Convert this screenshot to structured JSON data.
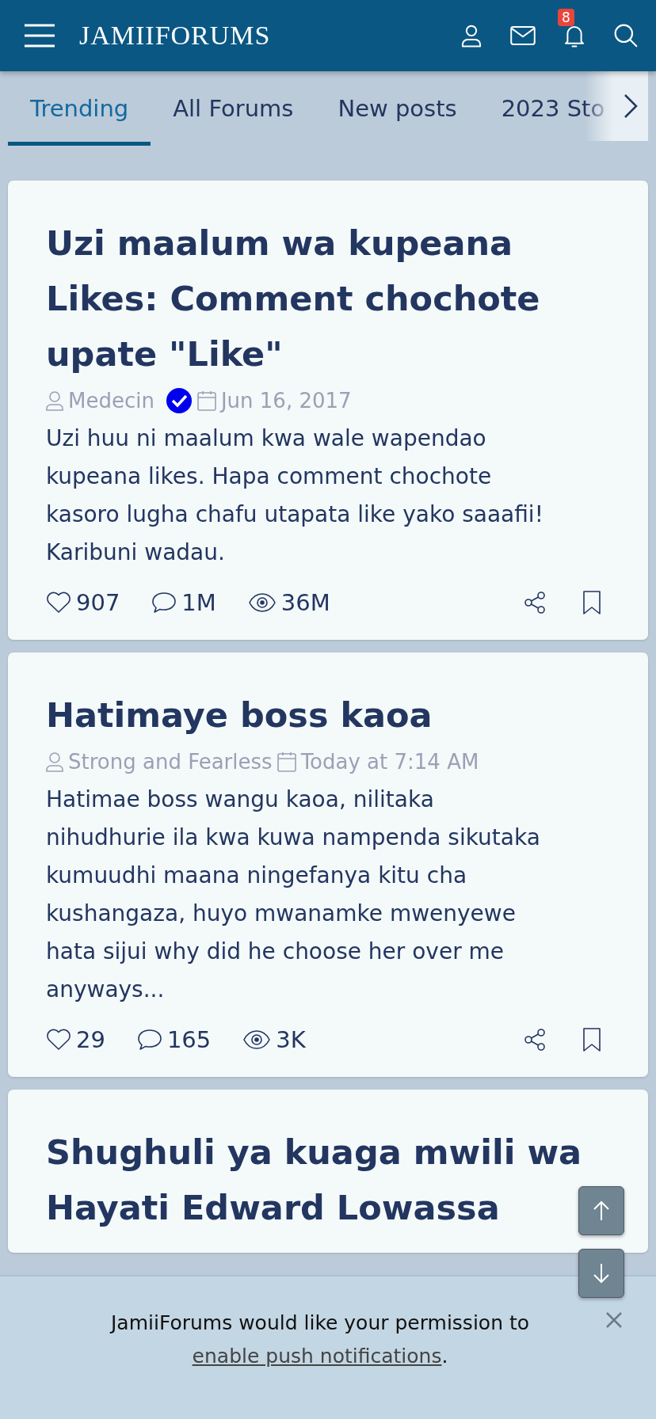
{
  "header": {
    "logo": "JAMIIFORUMS",
    "notification_count": "8"
  },
  "tabs": [
    {
      "label": "Trending",
      "selected": true
    },
    {
      "label": "All Forums",
      "selected": false
    },
    {
      "label": "New posts",
      "selected": false
    },
    {
      "label": "2023 Sto",
      "selected": false
    }
  ],
  "posts": [
    {
      "title": "Uzi maalum wa kupeana Likes: Comment chochote upate \"Like\"",
      "author": "Medecin",
      "verified": true,
      "date": "Jun 16, 2017",
      "excerpt": "Uzi huu ni maalum kwa wale wapendao kupeana likes. Hapa comment chochote kasoro lugha chafu utapata like yako saaafii! Karibuni wadau.",
      "likes": "907",
      "replies": "1M",
      "views": "36M"
    },
    {
      "title": "Hatimaye boss kaoa",
      "author": "Strong and Fearless",
      "verified": false,
      "date": "Today at 7:14 AM",
      "excerpt": "Hatimae boss wangu kaoa, nilitaka nihudhurie ila kwa kuwa nampenda sikutaka kumuudhi maana ningefanya kitu cha kushangaza, huyo mwanamke mwenyewe hata sijui why did he choose her over me anyways...",
      "likes": "29",
      "replies": "165",
      "views": "3K"
    },
    {
      "title": "Shughuli ya kuaga mwili wa Hayati Edward Lowassa"
    }
  ],
  "banner": {
    "text": "JamiiForums would like your permission to ",
    "link": "enable push notifications",
    "end": "."
  }
}
